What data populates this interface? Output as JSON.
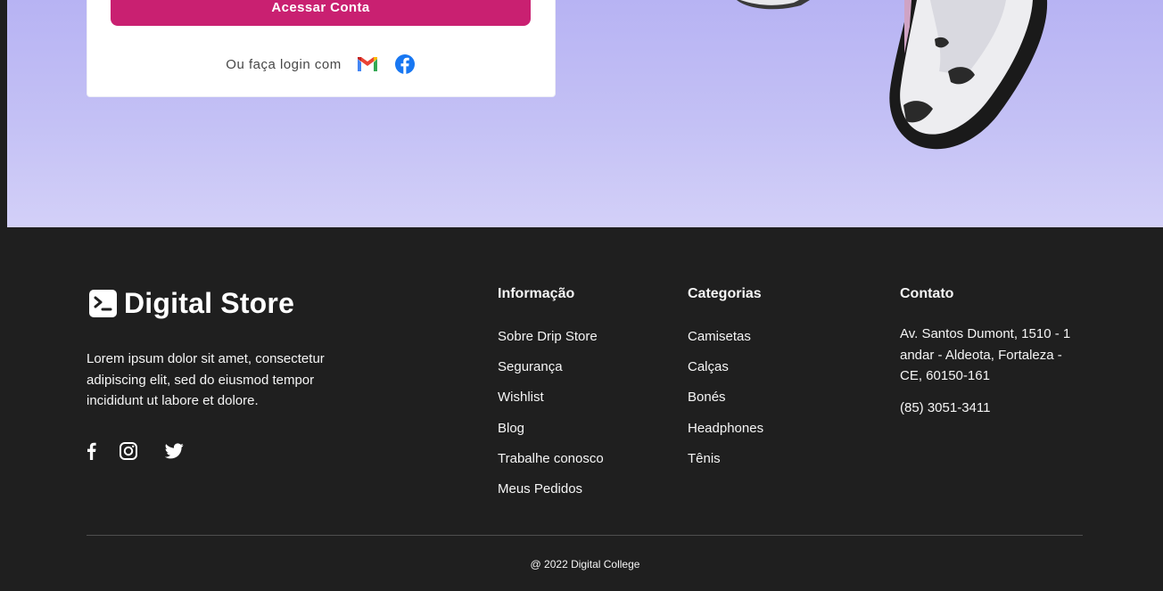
{
  "login": {
    "button_label": "Acessar Conta",
    "alt_text": "Ou faça login com",
    "providers": [
      "gmail-icon",
      "facebook-icon"
    ]
  },
  "footer": {
    "brand": "Digital Store",
    "about": "Lorem ipsum dolor sit amet, consectetur adipiscing elit, sed do eiusmod tempor incididunt ut labore et dolore.",
    "social": [
      "facebook-icon",
      "instagram-icon",
      "twitter-icon"
    ],
    "info": {
      "title": "Informação",
      "links": [
        "Sobre Drip Store",
        "Segurança",
        "Wishlist",
        "Blog",
        "Trabalhe conosco",
        "Meus Pedidos"
      ]
    },
    "categories": {
      "title": "Categorias",
      "links": [
        "Camisetas",
        "Calças",
        "Bonés",
        "Headphones",
        "Tênis"
      ]
    },
    "contact": {
      "title": "Contato",
      "address": "Av. Santos Dumont, 1510 - 1 andar - Aldeota, Fortaleza - CE, 60150-161",
      "phone": "(85) 3051-3411"
    },
    "copyright": "@ 2022 Digital College"
  },
  "colors": {
    "primary": "#c92071",
    "footer_bg": "#1f1f1f",
    "hero_bg": "#c4c1f5"
  }
}
